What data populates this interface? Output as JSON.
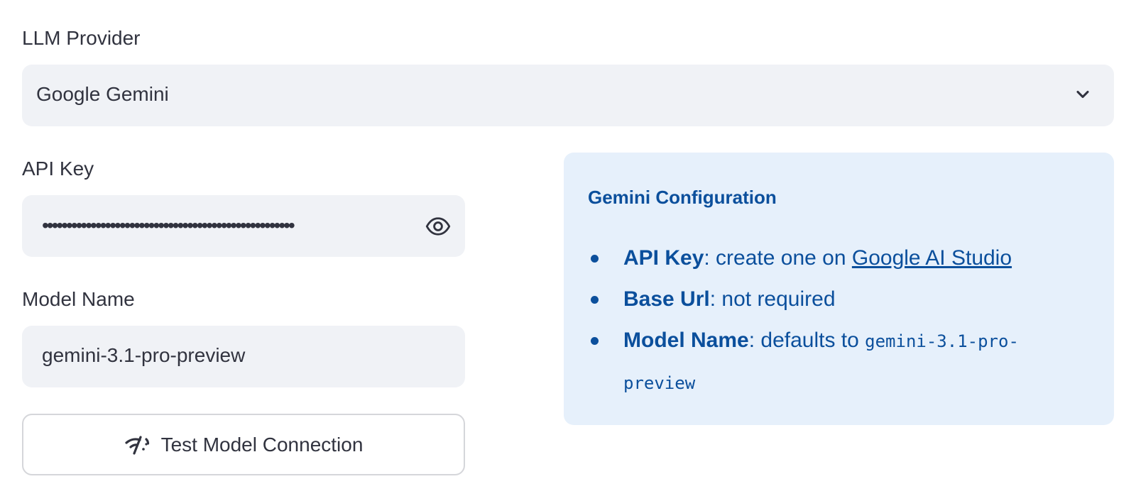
{
  "provider": {
    "label": "LLM Provider",
    "selected": "Google Gemini",
    "icon": "chevron-down-icon"
  },
  "api_key": {
    "label": "API Key",
    "value": "••••••••••••••••••••••••••••••••••••••••••••••••••••",
    "icon": "eye-icon"
  },
  "model_name": {
    "label": "Model Name",
    "value": "gemini-3.1-pro-preview"
  },
  "test_button": {
    "label": "Test Model Connection",
    "icon": "network-icon"
  },
  "info": {
    "title": "Gemini Configuration",
    "items": [
      {
        "key": "API Key",
        "text": ": create one on ",
        "link": "Google AI Studio"
      },
      {
        "key": "Base Url",
        "text": ": not required"
      },
      {
        "key": "Model Name",
        "text": ": defaults to ",
        "code": "gemini-3.1-pro-preview"
      }
    ]
  },
  "colors": {
    "input_bg": "#f0f2f6",
    "text": "#31333f",
    "info_bg": "#e6f0fb",
    "info_text": "#0b4f9c"
  }
}
